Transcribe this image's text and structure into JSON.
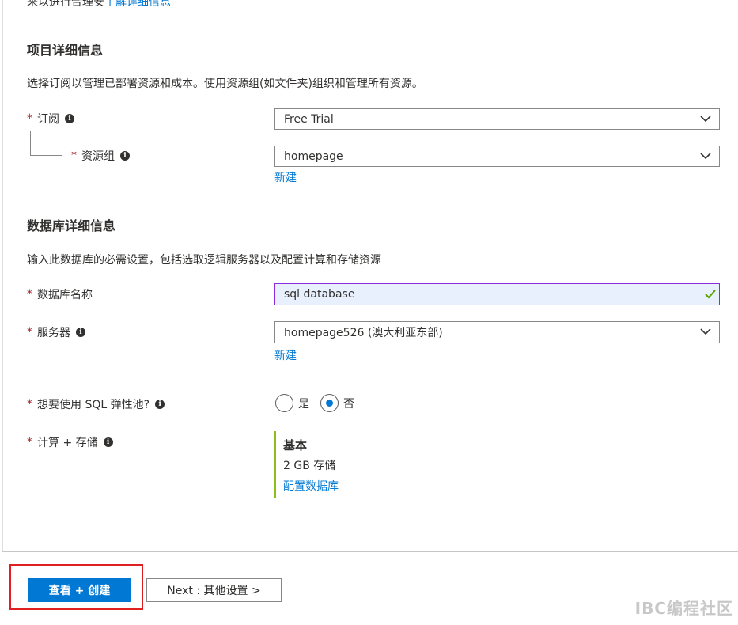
{
  "top_clip": {
    "text": "来以进行合理安",
    "link": "了解详细信息"
  },
  "project": {
    "heading": "项目详细信息",
    "description": "选择订阅以管理已部署资源和成本。使用资源组(如文件夹)组织和管理所有资源。",
    "subscription": {
      "label": "订阅",
      "value": "Free Trial"
    },
    "resource_group": {
      "label": "资源组",
      "value": "homepage",
      "new_link": "新建"
    }
  },
  "database": {
    "heading": "数据库详细信息",
    "description": "输入此数据库的必需设置，包括选取逻辑服务器以及配置计算和存储资源",
    "name": {
      "label": "数据库名称",
      "value": "sql database"
    },
    "server": {
      "label": "服务器",
      "value": "homepage526 (澳大利亚东部)",
      "new_link": "新建"
    },
    "elastic_pool": {
      "label": "想要使用 SQL 弹性池?",
      "options": [
        "是",
        "否"
      ],
      "selected": "否"
    },
    "compute": {
      "label": "计算 + 存储",
      "tier": "基本",
      "storage": "2 GB 存储",
      "configure_link": "配置数据库"
    }
  },
  "footer": {
    "review_create": "查看 + 创建",
    "next": "Next : 其他设置 >"
  },
  "watermark": "IBC编程社区",
  "colors": {
    "accent": "#0078d4",
    "required": "#a4262c",
    "tier_bar": "#8cbd18",
    "highlight": "#e02020"
  }
}
